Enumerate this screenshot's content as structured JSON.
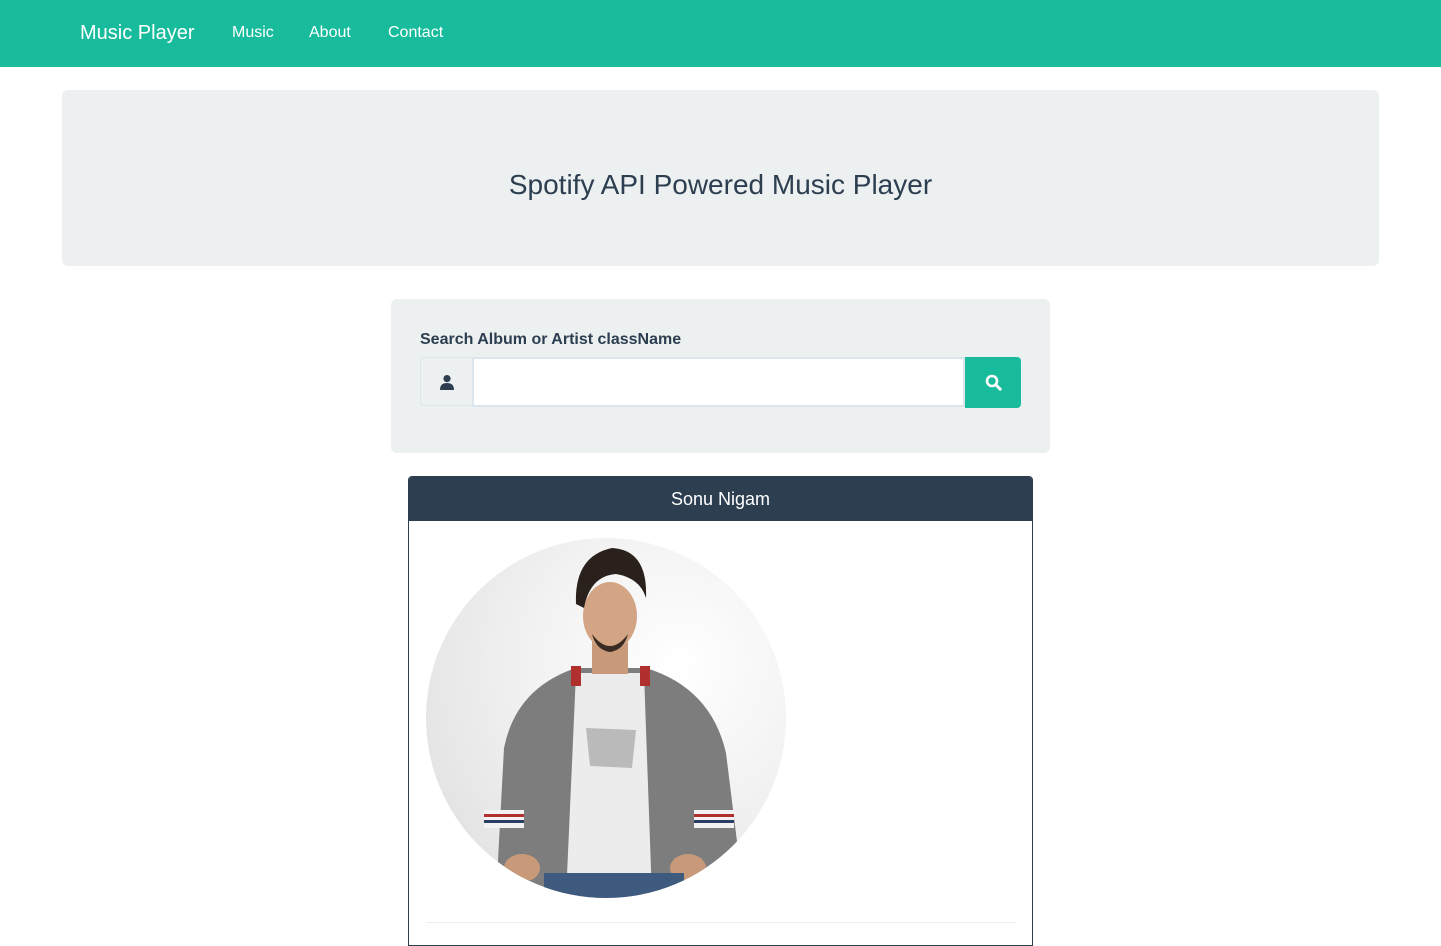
{
  "navbar": {
    "brand": "Music Player",
    "links": [
      "Music",
      "About",
      "Contact"
    ],
    "color": "#18bc9c"
  },
  "jumbotron": {
    "title": "Spotify API Powered Music Player"
  },
  "search": {
    "label": "Search Album or Artist className",
    "value": "",
    "placeholder": "",
    "addon_icon": "user-icon",
    "button_icon": "search-icon"
  },
  "artist": {
    "name": "Sonu Nigam",
    "photo": "artist-photo",
    "header_color": "#2c3e50"
  }
}
